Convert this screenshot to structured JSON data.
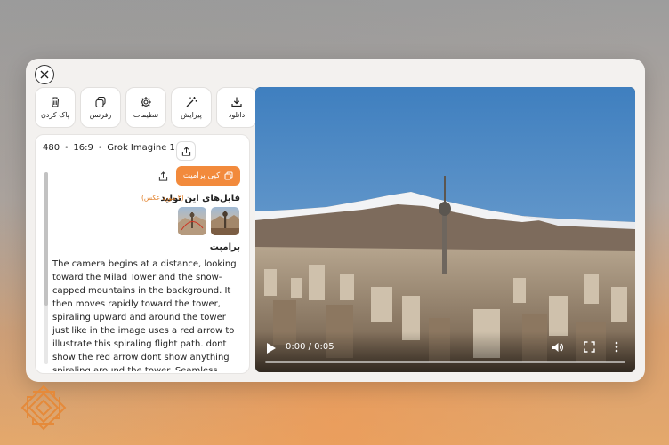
{
  "toolbar": {
    "items": [
      {
        "label": "پاک کردن",
        "icon": "trash-icon"
      },
      {
        "label": "رفرنس",
        "icon": "layers-icon"
      },
      {
        "label": "تنظیمات",
        "icon": "gear-icon"
      },
      {
        "label": "پیرایش",
        "icon": "magic-wand-icon"
      },
      {
        "label": "دانلود",
        "icon": "download-icon"
      }
    ]
  },
  "meta": {
    "resolution": "480",
    "aspect": "16:9",
    "model": "Grok Imagine 1.5"
  },
  "copy_prompt_label": "کپی پرامپت",
  "files": {
    "title": "فایل‌های این تولید",
    "count": "(۲ مورد عکس)"
  },
  "prompt": {
    "title": "پرامپت",
    "text": "The camera begins at a distance, looking toward the Milad Tower and the snow-capped mountains in the background. It then moves rapidly toward the tower, spiraling upward and around the tower just like in the image uses a red arrow to illustrate this spiraling flight path. dont show the red arrow dont show anything spiraling around the tower. Seamless entry: As the camera reaches the top of the tower, it"
  },
  "video": {
    "time": "0:00 / 0:05",
    "progress": 0
  },
  "colors": {
    "accent": "#f28a3c",
    "files_count": "#e07a20"
  }
}
